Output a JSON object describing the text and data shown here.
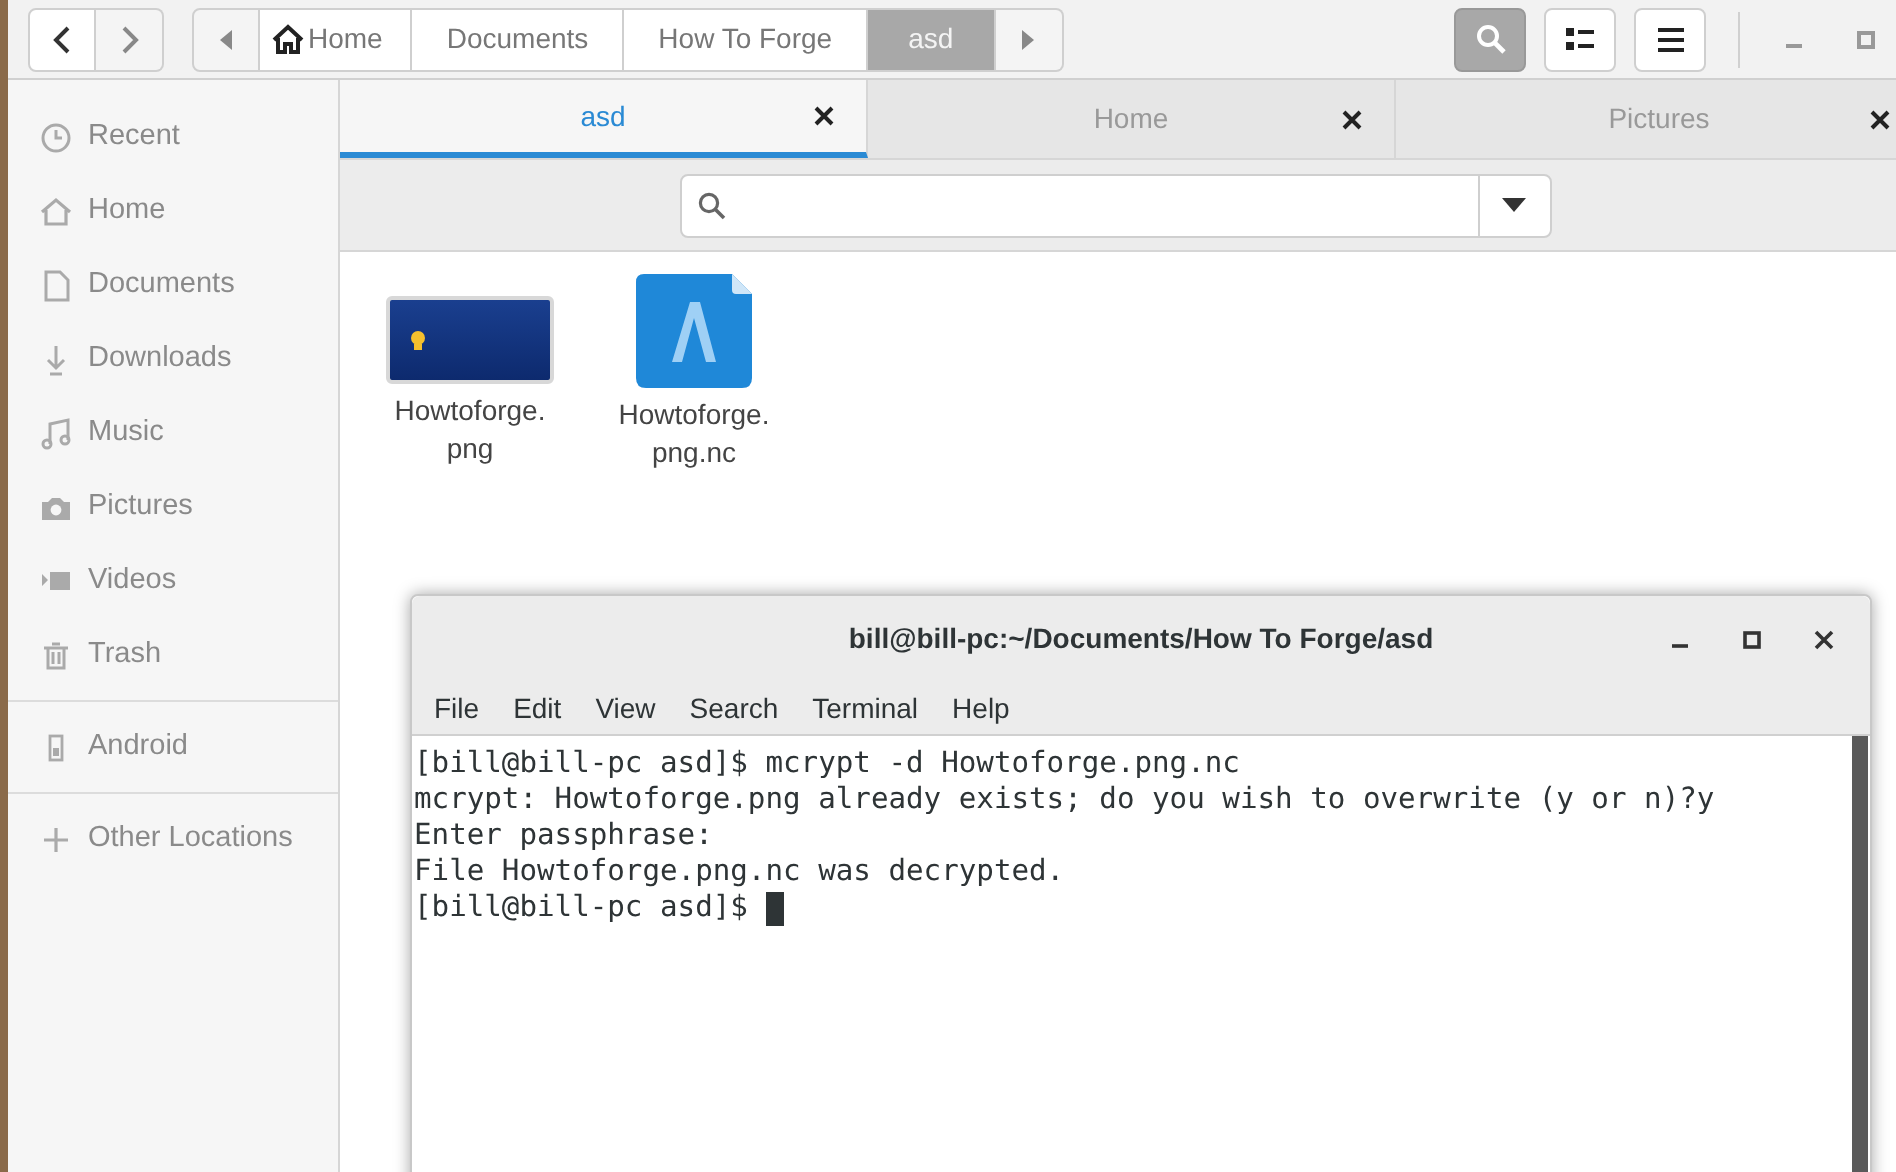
{
  "path_bar": [
    {
      "label": "Home",
      "selected": false
    },
    {
      "label": "Documents",
      "selected": false
    },
    {
      "label": "How To Forge",
      "selected": false
    },
    {
      "label": "asd",
      "selected": true
    }
  ],
  "view_buttons": [
    {
      "kind": "search",
      "selected": true
    },
    {
      "kind": "list",
      "selected": false
    },
    {
      "kind": "menu",
      "selected": false
    }
  ],
  "sidebar": {
    "sections": [
      [
        "Recent",
        "Home",
        "Documents",
        "Downloads",
        "Music",
        "Pictures",
        "Videos",
        "Trash"
      ],
      [
        "Android"
      ],
      [
        "Other Locations"
      ]
    ]
  },
  "tabs": [
    {
      "label": "asd",
      "selected": true
    },
    {
      "label": "Home",
      "selected": false
    },
    {
      "label": "Pictures",
      "selected": false
    }
  ],
  "files": [
    {
      "kind": "image",
      "name_lines": [
        "Howtoforge.",
        "png"
      ]
    },
    {
      "kind": "encrypted",
      "name_lines": [
        "Howtoforge.",
        "png.nc"
      ]
    }
  ],
  "terminal": {
    "title": "bill@bill-pc:~/Documents/How To Forge/asd",
    "menu": [
      "File",
      "Edit",
      "View",
      "Search",
      "Terminal",
      "Help"
    ],
    "lines": [
      "[bill@bill-pc asd]$ mcrypt -d Howtoforge.png.nc",
      "mcrypt: Howtoforge.png already exists; do you wish to overwrite (y or n)?y",
      "Enter passphrase:",
      "File Howtoforge.png.nc was decrypted.",
      "[bill@bill-pc asd]$ "
    ],
    "cursor": true
  }
}
